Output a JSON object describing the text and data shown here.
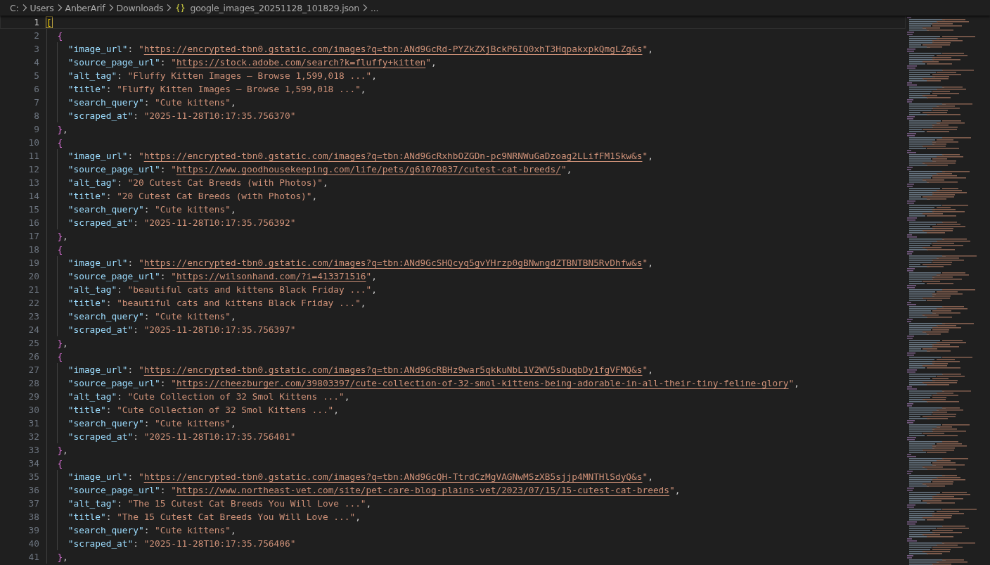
{
  "breadcrumb": [
    {
      "kind": "folder",
      "text": "C:"
    },
    {
      "kind": "folder",
      "text": "Users"
    },
    {
      "kind": "folder",
      "text": "AnberArif"
    },
    {
      "kind": "folder",
      "text": "Downloads"
    },
    {
      "kind": "file",
      "text": "google_images_20251128_101829.json"
    },
    {
      "kind": "more",
      "text": "..."
    }
  ],
  "editor": {
    "lines": [
      {
        "number": "1",
        "selected": true,
        "tokens": [
          {
            "kind": "bracket-match",
            "text": "["
          }
        ],
        "children": [
          {
            "number": "2",
            "selected": false,
            "tokens": [
              {
                "kind": "brace",
                "text": "{"
              }
            ],
            "children": [
              {
                "number": "3",
                "selected": false,
                "tokens": [
                  {
                    "kind": "key",
                    "text": "\"image_url\""
                  },
                  {
                    "kind": "punct",
                    "text": ": "
                  },
                  {
                    "kind": "string",
                    "text": "\""
                  },
                  {
                    "kind": "link",
                    "text": "https://encrypted-tbn0.gstatic.com/images?q=tbn:ANd9GcRd-PYZkZXjBckP6IQ0xhT3HqpakxpkQmgLZg&s"
                  },
                  {
                    "kind": "string",
                    "text": "\""
                  },
                  {
                    "kind": "punct",
                    "text": ","
                  }
                ]
              },
              {
                "number": "4",
                "selected": false,
                "tokens": [
                  {
                    "kind": "key",
                    "text": "\"source_page_url\""
                  },
                  {
                    "kind": "punct",
                    "text": ": "
                  },
                  {
                    "kind": "string",
                    "text": "\""
                  },
                  {
                    "kind": "link",
                    "text": "https://stock.adobe.com/search?k=fluffy+kitten"
                  },
                  {
                    "kind": "string",
                    "text": "\""
                  },
                  {
                    "kind": "punct",
                    "text": ","
                  }
                ]
              },
              {
                "number": "5",
                "selected": false,
                "tokens": [
                  {
                    "kind": "key",
                    "text": "\"alt_tag\""
                  },
                  {
                    "kind": "punct",
                    "text": ": "
                  },
                  {
                    "kind": "string",
                    "text": "\"Fluffy Kitten Images – Browse 1,599,018 ...\""
                  },
                  {
                    "kind": "punct",
                    "text": ","
                  }
                ]
              },
              {
                "number": "6",
                "selected": false,
                "tokens": [
                  {
                    "kind": "key",
                    "text": "\"title\""
                  },
                  {
                    "kind": "punct",
                    "text": ": "
                  },
                  {
                    "kind": "string",
                    "text": "\"Fluffy Kitten Images – Browse 1,599,018 ...\""
                  },
                  {
                    "kind": "punct",
                    "text": ","
                  }
                ]
              },
              {
                "number": "7",
                "selected": false,
                "tokens": [
                  {
                    "kind": "key",
                    "text": "\"search_query\""
                  },
                  {
                    "kind": "punct",
                    "text": ": "
                  },
                  {
                    "kind": "string",
                    "text": "\"Cute kittens\""
                  },
                  {
                    "kind": "punct",
                    "text": ","
                  }
                ]
              },
              {
                "number": "8",
                "selected": false,
                "tokens": [
                  {
                    "kind": "key",
                    "text": "\"scraped_at\""
                  },
                  {
                    "kind": "punct",
                    "text": ": "
                  },
                  {
                    "kind": "string",
                    "text": "\"2025-11-28T10:17:35.756370\""
                  }
                ]
              }
            ]
          },
          {
            "number": "9",
            "selected": false,
            "tokens": [
              {
                "kind": "brace",
                "text": "}"
              },
              {
                "kind": "punct",
                "text": ","
              }
            ]
          },
          {
            "number": "10",
            "selected": false,
            "tokens": [
              {
                "kind": "brace",
                "text": "{"
              }
            ],
            "children": [
              {
                "number": "11",
                "selected": false,
                "tokens": [
                  {
                    "kind": "key",
                    "text": "\"image_url\""
                  },
                  {
                    "kind": "punct",
                    "text": ": "
                  },
                  {
                    "kind": "string",
                    "text": "\""
                  },
                  {
                    "kind": "link",
                    "text": "https://encrypted-tbn0.gstatic.com/images?q=tbn:ANd9GcRxhbOZGDn-pc9NRNWuGaDzoag2LLifFM1Skw&s"
                  },
                  {
                    "kind": "string",
                    "text": "\""
                  },
                  {
                    "kind": "punct",
                    "text": ","
                  }
                ]
              },
              {
                "number": "12",
                "selected": false,
                "tokens": [
                  {
                    "kind": "key",
                    "text": "\"source_page_url\""
                  },
                  {
                    "kind": "punct",
                    "text": ": "
                  },
                  {
                    "kind": "string",
                    "text": "\""
                  },
                  {
                    "kind": "link",
                    "text": "https://www.goodhousekeeping.com/life/pets/g61070837/cutest-cat-breeds/"
                  },
                  {
                    "kind": "string",
                    "text": "\""
                  },
                  {
                    "kind": "punct",
                    "text": ","
                  }
                ]
              },
              {
                "number": "13",
                "selected": false,
                "tokens": [
                  {
                    "kind": "key",
                    "text": "\"alt_tag\""
                  },
                  {
                    "kind": "punct",
                    "text": ": "
                  },
                  {
                    "kind": "string",
                    "text": "\"20 Cutest Cat Breeds (with Photos)\""
                  },
                  {
                    "kind": "punct",
                    "text": ","
                  }
                ]
              },
              {
                "number": "14",
                "selected": false,
                "tokens": [
                  {
                    "kind": "key",
                    "text": "\"title\""
                  },
                  {
                    "kind": "punct",
                    "text": ": "
                  },
                  {
                    "kind": "string",
                    "text": "\"20 Cutest Cat Breeds (with Photos)\""
                  },
                  {
                    "kind": "punct",
                    "text": ","
                  }
                ]
              },
              {
                "number": "15",
                "selected": false,
                "tokens": [
                  {
                    "kind": "key",
                    "text": "\"search_query\""
                  },
                  {
                    "kind": "punct",
                    "text": ": "
                  },
                  {
                    "kind": "string",
                    "text": "\"Cute kittens\""
                  },
                  {
                    "kind": "punct",
                    "text": ","
                  }
                ]
              },
              {
                "number": "16",
                "selected": false,
                "tokens": [
                  {
                    "kind": "key",
                    "text": "\"scraped_at\""
                  },
                  {
                    "kind": "punct",
                    "text": ": "
                  },
                  {
                    "kind": "string",
                    "text": "\"2025-11-28T10:17:35.756392\""
                  }
                ]
              }
            ]
          },
          {
            "number": "17",
            "selected": false,
            "tokens": [
              {
                "kind": "brace",
                "text": "}"
              },
              {
                "kind": "punct",
                "text": ","
              }
            ]
          },
          {
            "number": "18",
            "selected": false,
            "tokens": [
              {
                "kind": "brace",
                "text": "{"
              }
            ],
            "children": [
              {
                "number": "19",
                "selected": false,
                "tokens": [
                  {
                    "kind": "key",
                    "text": "\"image_url\""
                  },
                  {
                    "kind": "punct",
                    "text": ": "
                  },
                  {
                    "kind": "string",
                    "text": "\""
                  },
                  {
                    "kind": "link",
                    "text": "https://encrypted-tbn0.gstatic.com/images?q=tbn:ANd9GcSHQcyq5gvYHrzp0gBNwngdZTBNTBN5RvDhfw&s"
                  },
                  {
                    "kind": "string",
                    "text": "\""
                  },
                  {
                    "kind": "punct",
                    "text": ","
                  }
                ]
              },
              {
                "number": "20",
                "selected": false,
                "tokens": [
                  {
                    "kind": "key",
                    "text": "\"source_page_url\""
                  },
                  {
                    "kind": "punct",
                    "text": ": "
                  },
                  {
                    "kind": "string",
                    "text": "\""
                  },
                  {
                    "kind": "link",
                    "text": "https://wilsonhand.com/?i=413371516"
                  },
                  {
                    "kind": "string",
                    "text": "\""
                  },
                  {
                    "kind": "punct",
                    "text": ","
                  }
                ]
              },
              {
                "number": "21",
                "selected": false,
                "tokens": [
                  {
                    "kind": "key",
                    "text": "\"alt_tag\""
                  },
                  {
                    "kind": "punct",
                    "text": ": "
                  },
                  {
                    "kind": "string",
                    "text": "\"beautiful cats and kittens Black Friday ...\""
                  },
                  {
                    "kind": "punct",
                    "text": ","
                  }
                ]
              },
              {
                "number": "22",
                "selected": false,
                "tokens": [
                  {
                    "kind": "key",
                    "text": "\"title\""
                  },
                  {
                    "kind": "punct",
                    "text": ": "
                  },
                  {
                    "kind": "string",
                    "text": "\"beautiful cats and kittens Black Friday ...\""
                  },
                  {
                    "kind": "punct",
                    "text": ","
                  }
                ]
              },
              {
                "number": "23",
                "selected": false,
                "tokens": [
                  {
                    "kind": "key",
                    "text": "\"search_query\""
                  },
                  {
                    "kind": "punct",
                    "text": ": "
                  },
                  {
                    "kind": "string",
                    "text": "\"Cute kittens\""
                  },
                  {
                    "kind": "punct",
                    "text": ","
                  }
                ]
              },
              {
                "number": "24",
                "selected": false,
                "tokens": [
                  {
                    "kind": "key",
                    "text": "\"scraped_at\""
                  },
                  {
                    "kind": "punct",
                    "text": ": "
                  },
                  {
                    "kind": "string",
                    "text": "\"2025-11-28T10:17:35.756397\""
                  }
                ]
              }
            ]
          },
          {
            "number": "25",
            "selected": false,
            "tokens": [
              {
                "kind": "brace",
                "text": "}"
              },
              {
                "kind": "punct",
                "text": ","
              }
            ]
          },
          {
            "number": "26",
            "selected": false,
            "tokens": [
              {
                "kind": "brace",
                "text": "{"
              }
            ],
            "children": [
              {
                "number": "27",
                "selected": false,
                "tokens": [
                  {
                    "kind": "key",
                    "text": "\"image_url\""
                  },
                  {
                    "kind": "punct",
                    "text": ": "
                  },
                  {
                    "kind": "string",
                    "text": "\""
                  },
                  {
                    "kind": "link",
                    "text": "https://encrypted-tbn0.gstatic.com/images?q=tbn:ANd9GcRBHz9war5qkkuNbL1V2WV5sDuqbDy1fgVFMQ&s"
                  },
                  {
                    "kind": "string",
                    "text": "\""
                  },
                  {
                    "kind": "punct",
                    "text": ","
                  }
                ]
              },
              {
                "number": "28",
                "selected": false,
                "tokens": [
                  {
                    "kind": "key",
                    "text": "\"source_page_url\""
                  },
                  {
                    "kind": "punct",
                    "text": ": "
                  },
                  {
                    "kind": "string",
                    "text": "\""
                  },
                  {
                    "kind": "link",
                    "text": "https://cheezburger.com/39803397/cute-collection-of-32-smol-kittens-being-adorable-in-all-their-tiny-feline-glory"
                  },
                  {
                    "kind": "string",
                    "text": "\""
                  },
                  {
                    "kind": "punct",
                    "text": ","
                  }
                ]
              },
              {
                "number": "29",
                "selected": false,
                "tokens": [
                  {
                    "kind": "key",
                    "text": "\"alt_tag\""
                  },
                  {
                    "kind": "punct",
                    "text": ": "
                  },
                  {
                    "kind": "string",
                    "text": "\"Cute Collection of 32 Smol Kittens ...\""
                  },
                  {
                    "kind": "punct",
                    "text": ","
                  }
                ]
              },
              {
                "number": "30",
                "selected": false,
                "tokens": [
                  {
                    "kind": "key",
                    "text": "\"title\""
                  },
                  {
                    "kind": "punct",
                    "text": ": "
                  },
                  {
                    "kind": "string",
                    "text": "\"Cute Collection of 32 Smol Kittens ...\""
                  },
                  {
                    "kind": "punct",
                    "text": ","
                  }
                ]
              },
              {
                "number": "31",
                "selected": false,
                "tokens": [
                  {
                    "kind": "key",
                    "text": "\"search_query\""
                  },
                  {
                    "kind": "punct",
                    "text": ": "
                  },
                  {
                    "kind": "string",
                    "text": "\"Cute kittens\""
                  },
                  {
                    "kind": "punct",
                    "text": ","
                  }
                ]
              },
              {
                "number": "32",
                "selected": false,
                "tokens": [
                  {
                    "kind": "key",
                    "text": "\"scraped_at\""
                  },
                  {
                    "kind": "punct",
                    "text": ": "
                  },
                  {
                    "kind": "string",
                    "text": "\"2025-11-28T10:17:35.756401\""
                  }
                ]
              }
            ]
          },
          {
            "number": "33",
            "selected": false,
            "tokens": [
              {
                "kind": "brace",
                "text": "}"
              },
              {
                "kind": "punct",
                "text": ","
              }
            ]
          },
          {
            "number": "34",
            "selected": false,
            "tokens": [
              {
                "kind": "brace",
                "text": "{"
              }
            ],
            "children": [
              {
                "number": "35",
                "selected": false,
                "tokens": [
                  {
                    "kind": "key",
                    "text": "\"image_url\""
                  },
                  {
                    "kind": "punct",
                    "text": ": "
                  },
                  {
                    "kind": "string",
                    "text": "\""
                  },
                  {
                    "kind": "link",
                    "text": "https://encrypted-tbn0.gstatic.com/images?q=tbn:ANd9GcQH-TtrdCzMgVAGNwMSzXB5sjjp4MNTHlSdyQ&s"
                  },
                  {
                    "kind": "string",
                    "text": "\""
                  },
                  {
                    "kind": "punct",
                    "text": ","
                  }
                ]
              },
              {
                "number": "36",
                "selected": false,
                "tokens": [
                  {
                    "kind": "key",
                    "text": "\"source_page_url\""
                  },
                  {
                    "kind": "punct",
                    "text": ": "
                  },
                  {
                    "kind": "string",
                    "text": "\""
                  },
                  {
                    "kind": "link",
                    "text": "https://www.northeast-vet.com/site/pet-care-blog-plains-vet/2023/07/15/15-cutest-cat-breeds"
                  },
                  {
                    "kind": "string",
                    "text": "\""
                  },
                  {
                    "kind": "punct",
                    "text": ","
                  }
                ]
              },
              {
                "number": "37",
                "selected": false,
                "tokens": [
                  {
                    "kind": "key",
                    "text": "\"alt_tag\""
                  },
                  {
                    "kind": "punct",
                    "text": ": "
                  },
                  {
                    "kind": "string",
                    "text": "\"The 15 Cutest Cat Breeds You Will Love ...\""
                  },
                  {
                    "kind": "punct",
                    "text": ","
                  }
                ]
              },
              {
                "number": "38",
                "selected": false,
                "tokens": [
                  {
                    "kind": "key",
                    "text": "\"title\""
                  },
                  {
                    "kind": "punct",
                    "text": ": "
                  },
                  {
                    "kind": "string",
                    "text": "\"The 15 Cutest Cat Breeds You Will Love ...\""
                  },
                  {
                    "kind": "punct",
                    "text": ","
                  }
                ]
              },
              {
                "number": "39",
                "selected": false,
                "tokens": [
                  {
                    "kind": "key",
                    "text": "\"search_query\""
                  },
                  {
                    "kind": "punct",
                    "text": ": "
                  },
                  {
                    "kind": "string",
                    "text": "\"Cute kittens\""
                  },
                  {
                    "kind": "punct",
                    "text": ","
                  }
                ]
              },
              {
                "number": "40",
                "selected": false,
                "tokens": [
                  {
                    "kind": "key",
                    "text": "\"scraped_at\""
                  },
                  {
                    "kind": "punct",
                    "text": ": "
                  },
                  {
                    "kind": "string",
                    "text": "\"2025-11-28T10:17:35.756406\""
                  }
                ]
              }
            ]
          },
          {
            "number": "41",
            "selected": false,
            "tokens": [
              {
                "kind": "brace",
                "text": "}"
              },
              {
                "kind": "punct",
                "text": ","
              }
            ]
          }
        ]
      }
    ]
  }
}
